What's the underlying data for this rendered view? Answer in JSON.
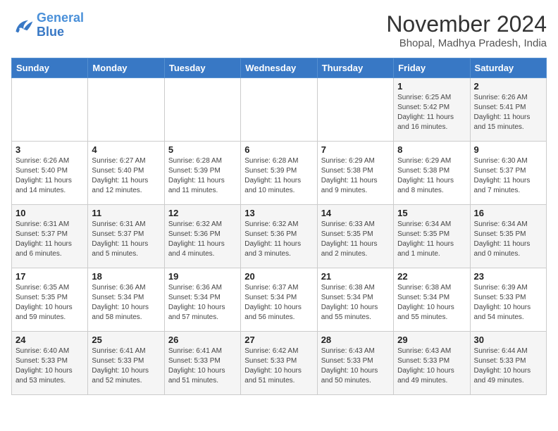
{
  "header": {
    "logo_line1": "General",
    "logo_line2": "Blue",
    "month_title": "November 2024",
    "location": "Bhopal, Madhya Pradesh, India"
  },
  "weekdays": [
    "Sunday",
    "Monday",
    "Tuesday",
    "Wednesday",
    "Thursday",
    "Friday",
    "Saturday"
  ],
  "weeks": [
    [
      {
        "day": "",
        "info": ""
      },
      {
        "day": "",
        "info": ""
      },
      {
        "day": "",
        "info": ""
      },
      {
        "day": "",
        "info": ""
      },
      {
        "day": "",
        "info": ""
      },
      {
        "day": "1",
        "info": "Sunrise: 6:25 AM\nSunset: 5:42 PM\nDaylight: 11 hours and 16 minutes."
      },
      {
        "day": "2",
        "info": "Sunrise: 6:26 AM\nSunset: 5:41 PM\nDaylight: 11 hours and 15 minutes."
      }
    ],
    [
      {
        "day": "3",
        "info": "Sunrise: 6:26 AM\nSunset: 5:40 PM\nDaylight: 11 hours and 14 minutes."
      },
      {
        "day": "4",
        "info": "Sunrise: 6:27 AM\nSunset: 5:40 PM\nDaylight: 11 hours and 12 minutes."
      },
      {
        "day": "5",
        "info": "Sunrise: 6:28 AM\nSunset: 5:39 PM\nDaylight: 11 hours and 11 minutes."
      },
      {
        "day": "6",
        "info": "Sunrise: 6:28 AM\nSunset: 5:39 PM\nDaylight: 11 hours and 10 minutes."
      },
      {
        "day": "7",
        "info": "Sunrise: 6:29 AM\nSunset: 5:38 PM\nDaylight: 11 hours and 9 minutes."
      },
      {
        "day": "8",
        "info": "Sunrise: 6:29 AM\nSunset: 5:38 PM\nDaylight: 11 hours and 8 minutes."
      },
      {
        "day": "9",
        "info": "Sunrise: 6:30 AM\nSunset: 5:37 PM\nDaylight: 11 hours and 7 minutes."
      }
    ],
    [
      {
        "day": "10",
        "info": "Sunrise: 6:31 AM\nSunset: 5:37 PM\nDaylight: 11 hours and 6 minutes."
      },
      {
        "day": "11",
        "info": "Sunrise: 6:31 AM\nSunset: 5:37 PM\nDaylight: 11 hours and 5 minutes."
      },
      {
        "day": "12",
        "info": "Sunrise: 6:32 AM\nSunset: 5:36 PM\nDaylight: 11 hours and 4 minutes."
      },
      {
        "day": "13",
        "info": "Sunrise: 6:32 AM\nSunset: 5:36 PM\nDaylight: 11 hours and 3 minutes."
      },
      {
        "day": "14",
        "info": "Sunrise: 6:33 AM\nSunset: 5:35 PM\nDaylight: 11 hours and 2 minutes."
      },
      {
        "day": "15",
        "info": "Sunrise: 6:34 AM\nSunset: 5:35 PM\nDaylight: 11 hours and 1 minute."
      },
      {
        "day": "16",
        "info": "Sunrise: 6:34 AM\nSunset: 5:35 PM\nDaylight: 11 hours and 0 minutes."
      }
    ],
    [
      {
        "day": "17",
        "info": "Sunrise: 6:35 AM\nSunset: 5:35 PM\nDaylight: 10 hours and 59 minutes."
      },
      {
        "day": "18",
        "info": "Sunrise: 6:36 AM\nSunset: 5:34 PM\nDaylight: 10 hours and 58 minutes."
      },
      {
        "day": "19",
        "info": "Sunrise: 6:36 AM\nSunset: 5:34 PM\nDaylight: 10 hours and 57 minutes."
      },
      {
        "day": "20",
        "info": "Sunrise: 6:37 AM\nSunset: 5:34 PM\nDaylight: 10 hours and 56 minutes."
      },
      {
        "day": "21",
        "info": "Sunrise: 6:38 AM\nSunset: 5:34 PM\nDaylight: 10 hours and 55 minutes."
      },
      {
        "day": "22",
        "info": "Sunrise: 6:38 AM\nSunset: 5:34 PM\nDaylight: 10 hours and 55 minutes."
      },
      {
        "day": "23",
        "info": "Sunrise: 6:39 AM\nSunset: 5:33 PM\nDaylight: 10 hours and 54 minutes."
      }
    ],
    [
      {
        "day": "24",
        "info": "Sunrise: 6:40 AM\nSunset: 5:33 PM\nDaylight: 10 hours and 53 minutes."
      },
      {
        "day": "25",
        "info": "Sunrise: 6:41 AM\nSunset: 5:33 PM\nDaylight: 10 hours and 52 minutes."
      },
      {
        "day": "26",
        "info": "Sunrise: 6:41 AM\nSunset: 5:33 PM\nDaylight: 10 hours and 51 minutes."
      },
      {
        "day": "27",
        "info": "Sunrise: 6:42 AM\nSunset: 5:33 PM\nDaylight: 10 hours and 51 minutes."
      },
      {
        "day": "28",
        "info": "Sunrise: 6:43 AM\nSunset: 5:33 PM\nDaylight: 10 hours and 50 minutes."
      },
      {
        "day": "29",
        "info": "Sunrise: 6:43 AM\nSunset: 5:33 PM\nDaylight: 10 hours and 49 minutes."
      },
      {
        "day": "30",
        "info": "Sunrise: 6:44 AM\nSunset: 5:33 PM\nDaylight: 10 hours and 49 minutes."
      }
    ]
  ]
}
